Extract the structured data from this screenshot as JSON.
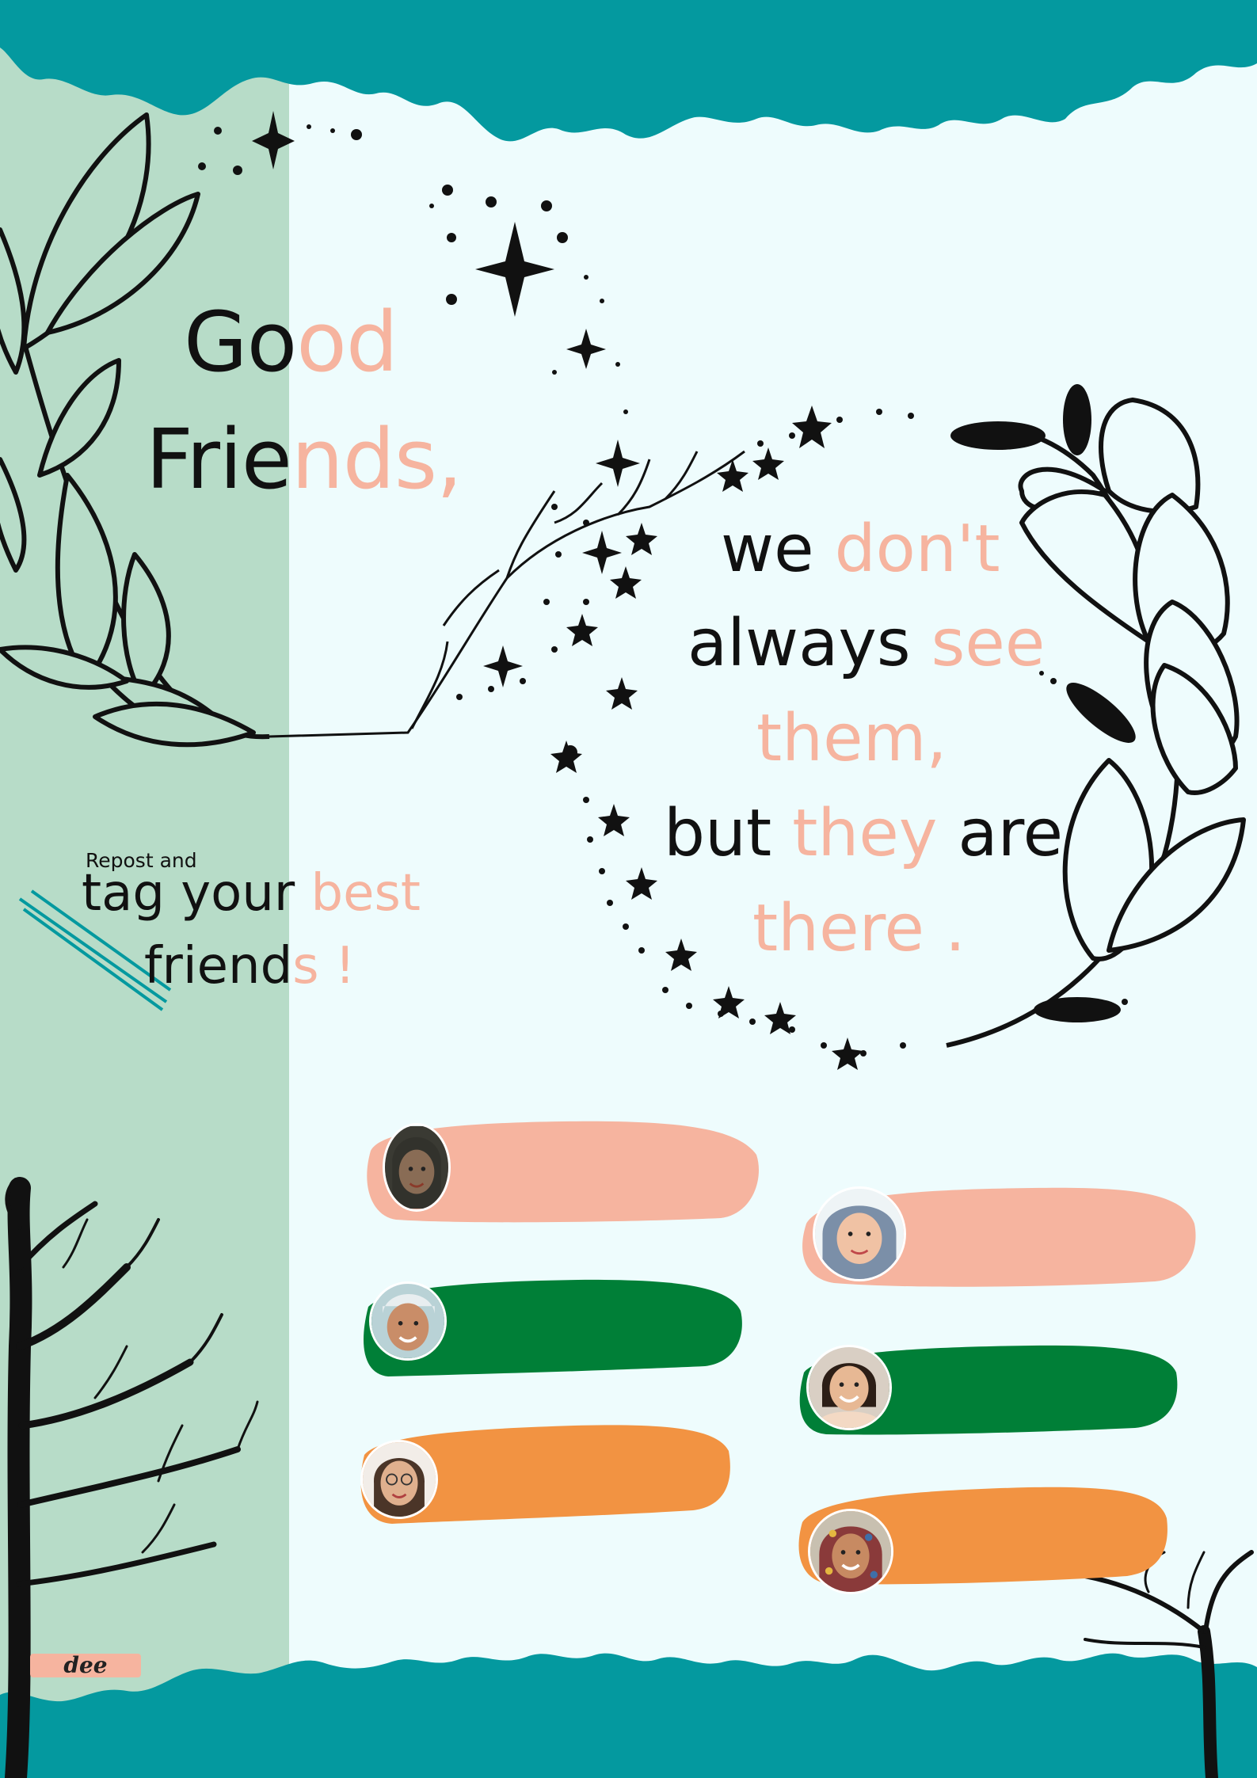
{
  "title": {
    "line1": {
      "dark": "Go",
      "pink": "od"
    },
    "line2": {
      "dark": "Frie",
      "pink": "nds,"
    }
  },
  "quote": {
    "line1": {
      "dark": "we ",
      "pink": "don't"
    },
    "line2": {
      "dark": "always ",
      "pink": "see"
    },
    "line3": {
      "pink": "them,"
    },
    "line4": {
      "dark1": "but ",
      "pink": "they",
      "dark2": " are"
    },
    "line5": {
      "pink": "there ."
    }
  },
  "cta": {
    "small": "Repost and",
    "line1": {
      "dark": "tag your ",
      "pink": "best"
    },
    "line2": {
      "dark": "friend",
      "pink": "s !"
    }
  },
  "signature": "dee",
  "colors": {
    "teal": "#04999F",
    "mint": "#B7DCC8",
    "background": "#EEFCFD",
    "peach": "#F6B49F",
    "green": "#007F37",
    "orange": "#F29342",
    "ink": "#111111"
  },
  "friends": [
    {
      "column": "left",
      "color": "peach",
      "avatar": "avatar-woman-hijab-dark"
    },
    {
      "column": "left",
      "color": "green",
      "avatar": "avatar-young-man"
    },
    {
      "column": "left",
      "color": "orange",
      "avatar": "avatar-woman-glasses"
    },
    {
      "column": "right",
      "color": "peach",
      "avatar": "avatar-woman-hijab-blue"
    },
    {
      "column": "right",
      "color": "green",
      "avatar": "avatar-woman-smiling"
    },
    {
      "column": "right",
      "color": "orange",
      "avatar": "avatar-woman-patterned-hijab"
    }
  ]
}
